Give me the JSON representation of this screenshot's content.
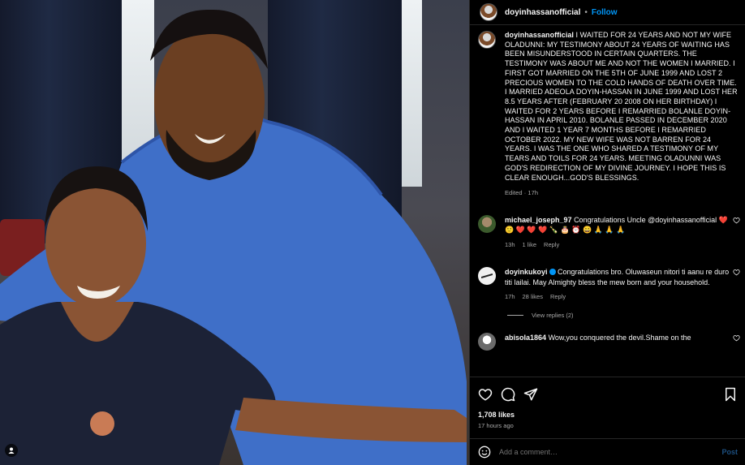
{
  "post": {
    "username": "doyinhassanofficial",
    "follow_label": "Follow",
    "separator": "•",
    "caption": "I WAITED FOR 24 YEARS AND NOT MY WIFE OLADUNNI: MY TESTIMONY ABOUT 24 YEARS OF WAITING HAS BEEN MISUNDERSTOOD IN CERTAIN QUARTERS. THE TESTIMONY WAS ABOUT ME AND NOT THE WOMEN I MARRIED. I FIRST GOT MARRIED ON THE 5TH OF JUNE 1999 AND LOST 2 PRECIOUS WOMEN TO THE COLD HANDS OF DEATH OVER TIME. I MARRIED ADEOLA DOYIN-HASSAN IN JUNE 1999 AND LOST HER 8.5 YEARS AFTER (FEBRUARY 20 2008 ON HER BIRTHDAY) I WAITED FOR 2 YEARS BEFORE I REMARRIED BOLANLE DOYIN-HASSAN IN APRIL 2010. BOLANLE PASSED IN DECEMBER 2020 AND I WAITED 1 YEAR 7 MONTHS BEFORE I REMARRIED OCTOBER 2022. MY NEW WIFE WAS NOT BARREN FOR 24 YEARS. I WAS THE ONE WHO SHARED A TESTIMONY OF MY TEARS AND TOILS FOR 24 YEARS. MEETING OLADUNNI WAS GOD'S REDIRECTION OF MY DIVINE JOURNEY. I HOPE THIS IS CLEAR ENOUGH...GOD'S BLESSINGS.",
    "caption_meta": "Edited · 17h",
    "likes": "1,708 likes",
    "time_ago": "17 hours ago",
    "add_comment_placeholder": "Add a comment…",
    "post_label": "Post"
  },
  "comments": [
    {
      "username": "michael_joseph_97",
      "text": "Congratulations Uncle @doyinhassanofficial",
      "emojis": "❤️ 🙂 ❤️ ❤️ ❤️ 🍾 🎂 ⏰ 😀 🙏 🙏 🙏",
      "time": "13h",
      "likes": "1 like",
      "reply": "Reply"
    },
    {
      "username": "doyinkukoyi",
      "text": "Congratulations bro. Oluwaseun nitori ti aanu re duro titi lailai. May Almighty bless the mew born and your household.",
      "time": "17h",
      "likes": "28 likes",
      "reply": "Reply",
      "view_replies": "View replies (2)"
    },
    {
      "username": "abisola1864",
      "text": "Wow,you conquered the devil.Shame on the"
    }
  ],
  "icons": [
    "heart-icon",
    "comment-icon",
    "share-icon",
    "bookmark-icon",
    "emoji-icon",
    "user-tag-icon"
  ],
  "colors": {
    "accent": "#0095f6",
    "background": "#000000",
    "muted": "#a8a8a8"
  }
}
